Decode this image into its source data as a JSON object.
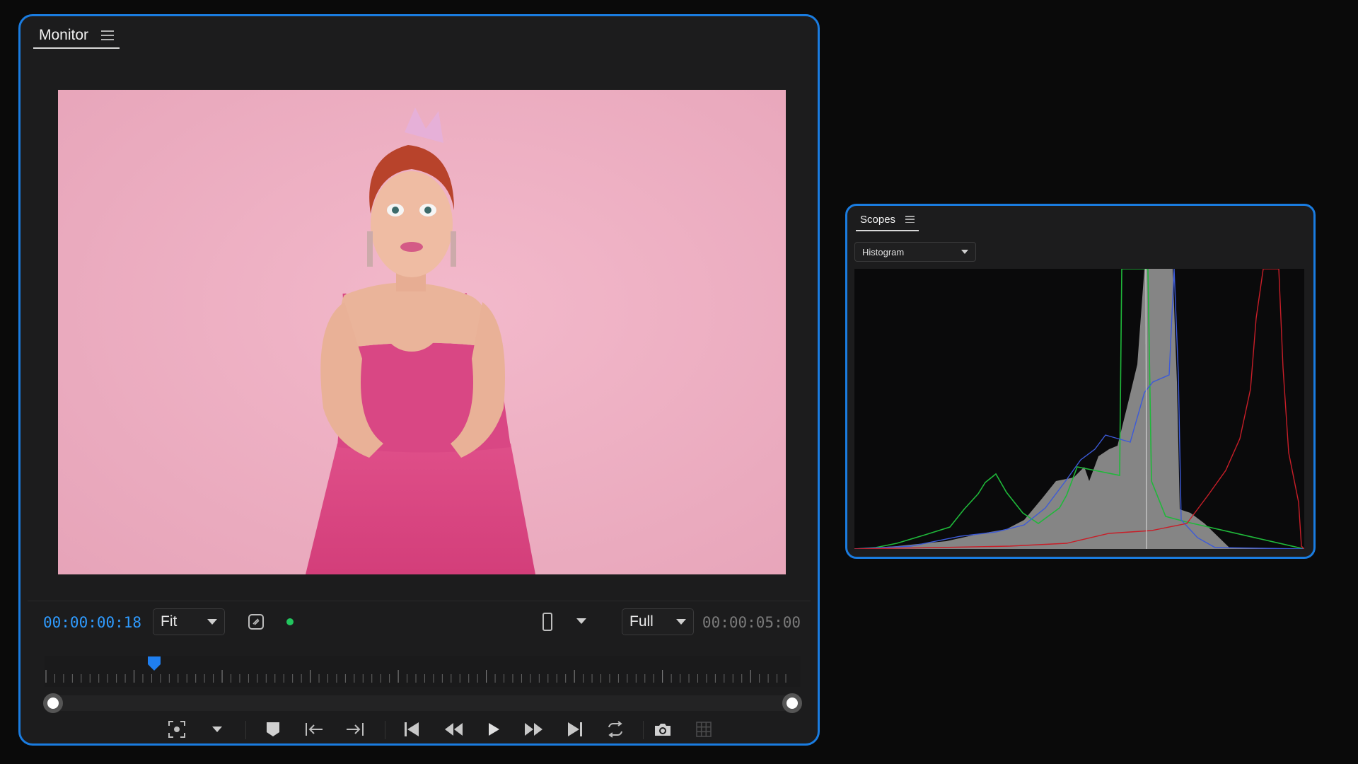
{
  "monitor": {
    "tab_label": "Monitor",
    "current_timecode": "00:00:00:18",
    "zoom_select": "Fit",
    "quality_select": "Full",
    "duration_timecode": "00:00:05:00",
    "playhead_fraction": 0.148,
    "icons": {
      "menu": "hamburger-menu-icon",
      "safe_margins": "safe-margins-icon",
      "status": "green-status-dot",
      "device": "mobile-device-icon",
      "transport": [
        "fullscreen-focus-icon",
        "chevron-down-icon",
        "marker-icon",
        "mark-in-icon",
        "mark-out-icon",
        "step-back-icon",
        "rewind-icon",
        "play-icon",
        "fast-forward-icon",
        "step-forward-icon",
        "loop-icon",
        "camera-icon",
        "grid-icon"
      ]
    },
    "colors": {
      "accent": "#2f9bff",
      "status": "#22c55e",
      "frame_bg": "#ecaec2"
    }
  },
  "scopes": {
    "tab_label": "Scopes",
    "scope_type": "Histogram",
    "colors": {
      "red": "#c81e28",
      "green": "#1fb83a",
      "blue": "#3c5ad8",
      "luma": "#8a8a8a"
    }
  }
}
